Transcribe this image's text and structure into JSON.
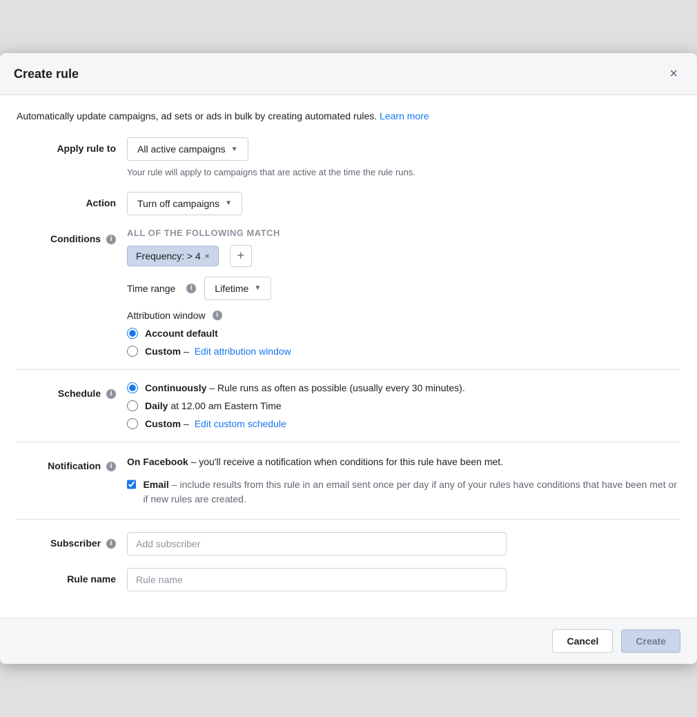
{
  "modal": {
    "title": "Create rule",
    "close_icon": "×"
  },
  "intro": {
    "text": "Automatically update campaigns, ad sets or ads in bulk by creating automated rules.",
    "learn_more_label": "Learn more"
  },
  "apply_rule": {
    "label": "Apply rule to",
    "dropdown_label": "All active campaigns",
    "description": "Your rule will apply to campaigns that are active at the time the rule runs."
  },
  "action": {
    "label": "Action",
    "dropdown_label": "Turn off campaigns"
  },
  "conditions": {
    "label": "Conditions",
    "all_label": "ALL of the following match",
    "tag_text": "Frequency:  >  4",
    "tag_remove": "×",
    "add_btn": "+"
  },
  "time_range": {
    "label": "Time range",
    "dropdown_label": "Lifetime"
  },
  "attribution": {
    "label": "Attribution window",
    "options": [
      {
        "id": "account-default",
        "label": "Account default",
        "checked": true
      },
      {
        "id": "custom",
        "label": "Custom",
        "checked": false,
        "edit_link": "Edit attribution window"
      }
    ]
  },
  "schedule": {
    "label": "Schedule",
    "options": [
      {
        "id": "continuously",
        "bold": "Continuously",
        "rest": " – Rule runs as often as possible (usually every 30 minutes).",
        "checked": true
      },
      {
        "id": "daily",
        "bold": "Daily",
        "rest": " at 12.00 am Eastern Time",
        "checked": false
      },
      {
        "id": "custom",
        "bold": "Custom",
        "rest": " – ",
        "edit_link": "Edit custom schedule",
        "checked": false
      }
    ]
  },
  "notification": {
    "label": "Notification",
    "on_facebook_text": "On Facebook – you'll receive a notification when conditions for this rule have been met.",
    "email_label": "Email – include results from this rule in an email sent once per day if any of your rules have conditions that have been met or if new rules are created.",
    "email_checked": true
  },
  "subscriber": {
    "label": "Subscriber",
    "placeholder": "Add subscriber"
  },
  "rule_name": {
    "label": "Rule name",
    "placeholder": "Rule name"
  },
  "footer": {
    "cancel_label": "Cancel",
    "create_label": "Create"
  }
}
